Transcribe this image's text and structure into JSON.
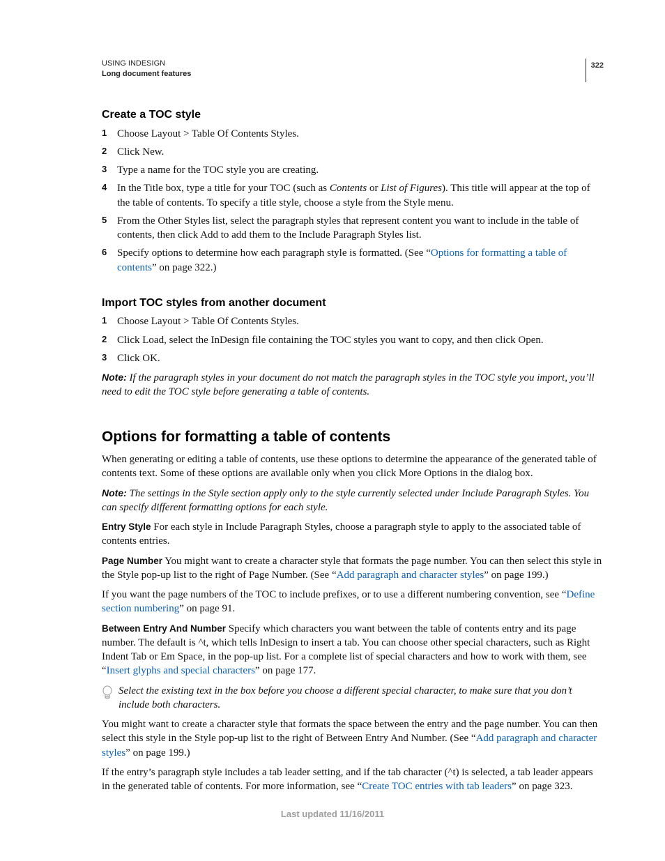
{
  "header": {
    "title": "USING INDESIGN",
    "subtitle": "Long document features",
    "page_number": "322"
  },
  "section1": {
    "heading": "Create a TOC style",
    "steps": [
      "Choose Layout > Table Of Contents Styles.",
      "Click New.",
      "Type a name for the TOC style you are creating.",
      {
        "pre": "In the Title box, type a title for your TOC (such as ",
        "em1": "Contents",
        "mid": " or ",
        "em2": "List of Figures",
        "post": "). This title will appear at the top of the table of contents. To specify a title style, choose a style from the Style menu."
      },
      "From the Other Styles list, select the paragraph styles that represent content you want to include in the table of contents, then click Add to add them to the Include Paragraph Styles list.",
      {
        "pre": "Specify options to determine how each paragraph style is formatted. (See “",
        "link": "Options for formatting a table of contents",
        "post": "” on page 322.)"
      }
    ]
  },
  "section2": {
    "heading": "Import TOC styles from another document",
    "steps": [
      "Choose Layout > Table Of Contents Styles.",
      "Click Load, select the InDesign file containing the TOC styles you want to copy, and then click Open.",
      "Click OK."
    ],
    "note_label": "Note:",
    "note_body": " If the paragraph styles in your document do not match the paragraph styles in the TOC style you import, you’ll need to edit the TOC style before generating a table of contents."
  },
  "section3": {
    "heading": "Options for formatting a table of contents",
    "intro": "When generating or editing a table of contents, use these options to determine the appearance of the generated table of contents text. Some of these options are available only when you click More Options in the dialog box.",
    "note_label": "Note:",
    "note_body": " The settings in the Style section apply only to the style currently selected under Include Paragraph Styles. You can specify different formatting options for each style.",
    "defs": {
      "entry_style_label": "Entry Style",
      "entry_style_body": "  For each style in Include Paragraph Styles, choose a paragraph style to apply to the associated table of contents entries.",
      "page_number_label": "Page Number",
      "page_number_pre": "  You might want to create a character style that formats the page number. You can then select this style in the Style pop-up list to the right of Page Number. (See “",
      "page_number_link": "Add paragraph and character styles",
      "page_number_post": "” on page 199.)",
      "page_number_extra_pre": "If you want the page numbers of the TOC to include prefixes, or to use a different numbering convention, see “",
      "page_number_extra_link": "Define section numbering",
      "page_number_extra_post": "” on page 91.",
      "between_label": "Between Entry And Number",
      "between_pre": "  Specify which characters you want between the table of contents entry and its page number. The default is ^t, which tells InDesign to insert a tab. You can choose other special characters, such as Right Indent Tab or Em Space, in the pop-up list. For a complete list of special characters and how to work with them, see “",
      "between_link": "Insert glyphs and special characters",
      "between_post": "” on page 177.",
      "tip": "Select the existing text in the box before you choose a different special character, to make sure that you don’t include both characters.",
      "charstyle_pre": "You might want to create a character style that formats the space between the entry and the page number. You can then select this style in the Style pop-up list to the right of Between Entry And Number. (See “",
      "charstyle_link": "Add paragraph and character styles",
      "charstyle_post": "” on page 199.)",
      "tableader_pre": "If the entry’s paragraph style includes a tab leader setting, and if the tab character (^t) is selected, a tab leader appears in the generated table of contents. For more information, see “",
      "tableader_link": "Create TOC entries with tab leaders",
      "tableader_post": "” on page 323."
    }
  },
  "footer": "Last updated 11/16/2011"
}
